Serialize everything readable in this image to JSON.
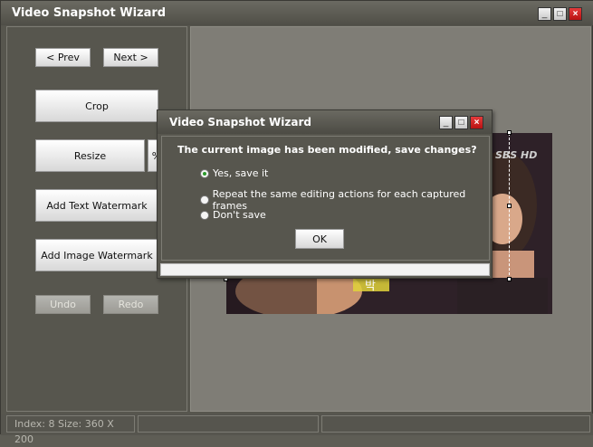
{
  "window": {
    "title": "Video Snapshot Wizard",
    "minimize_label": "_",
    "maximize_label": "□",
    "close_label": "×"
  },
  "left_panel": {
    "prev_label": "< Prev",
    "next_label": "Next >",
    "crop_label": "Crop",
    "resize_label": "Resize",
    "percent_label": "%",
    "add_text_watermark_label": "Add Text Watermark",
    "add_image_watermark_label": "Add Image Watermark",
    "undo_label": "Undo",
    "redo_label": "Redo"
  },
  "preview": {
    "channel_logo": "SBS HD",
    "subtitle_text": "박"
  },
  "statusbar": {
    "index_size": "Index: 8  Size: 360 X 200",
    "cell2": "",
    "cell3": ""
  },
  "dialog": {
    "title": "Video Snapshot Wizard",
    "minimize_label": "_",
    "maximize_label": "□",
    "close_label": "×",
    "message": "The current image has been modified,  save changes?",
    "options": [
      {
        "label": "Yes, save it",
        "checked": true
      },
      {
        "label": "Repeat the same editing actions for each captured frames",
        "checked": false
      },
      {
        "label": "Don't save",
        "checked": false
      }
    ],
    "ok_label": "OK"
  }
}
